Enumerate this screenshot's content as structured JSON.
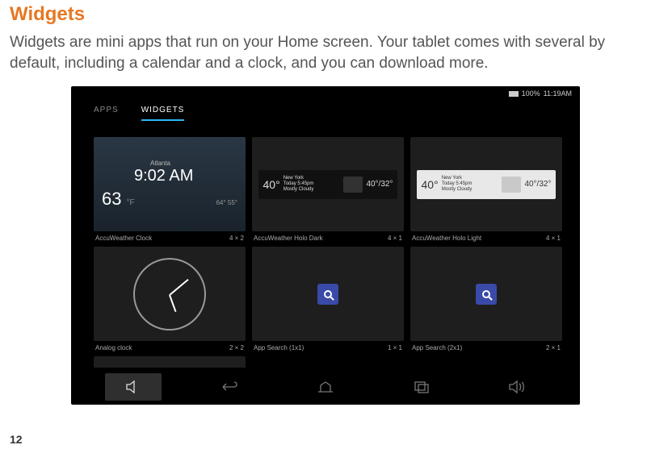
{
  "page": {
    "title": "Widgets",
    "body": "Widgets are mini apps that run on your Home screen. Your tablet comes with several by default, including a calendar and a clock, and you can download more.",
    "number": "12"
  },
  "statusbar": {
    "battery": "100%",
    "time": "11:19AM"
  },
  "tabs": {
    "apps": "APPS",
    "widgets": "WIDGETS"
  },
  "widgets": {
    "w0": {
      "name": "AccuWeather Clock",
      "size": "4 × 2"
    },
    "w1": {
      "name": "AccuWeather Holo Dark",
      "size": "4 × 1"
    },
    "w2": {
      "name": "AccuWeather Holo Light",
      "size": "4 × 1"
    },
    "w3": {
      "name": "Analog clock",
      "size": "2 × 2"
    },
    "w4": {
      "name": "App Search (1x1)",
      "size": "1 × 1"
    },
    "w5": {
      "name": "App Search (2x1)",
      "size": "2 × 1"
    }
  },
  "preview": {
    "aw_clock": {
      "location": "Atlanta",
      "time": "9:02 AM",
      "temp": "63",
      "unit": "°F",
      "hilo": "64° 55°"
    },
    "aw_dark": {
      "temp": "40°",
      "city": "New York",
      "line2": "Today 5:45pm",
      "line3": "Mostly Cloudy",
      "hilo": "40°/32°"
    },
    "aw_light": {
      "temp": "40°",
      "city": "New York",
      "line2": "Today 5:45pm",
      "line3": "Mostly Cloudy",
      "hilo": "40°/32°"
    }
  }
}
